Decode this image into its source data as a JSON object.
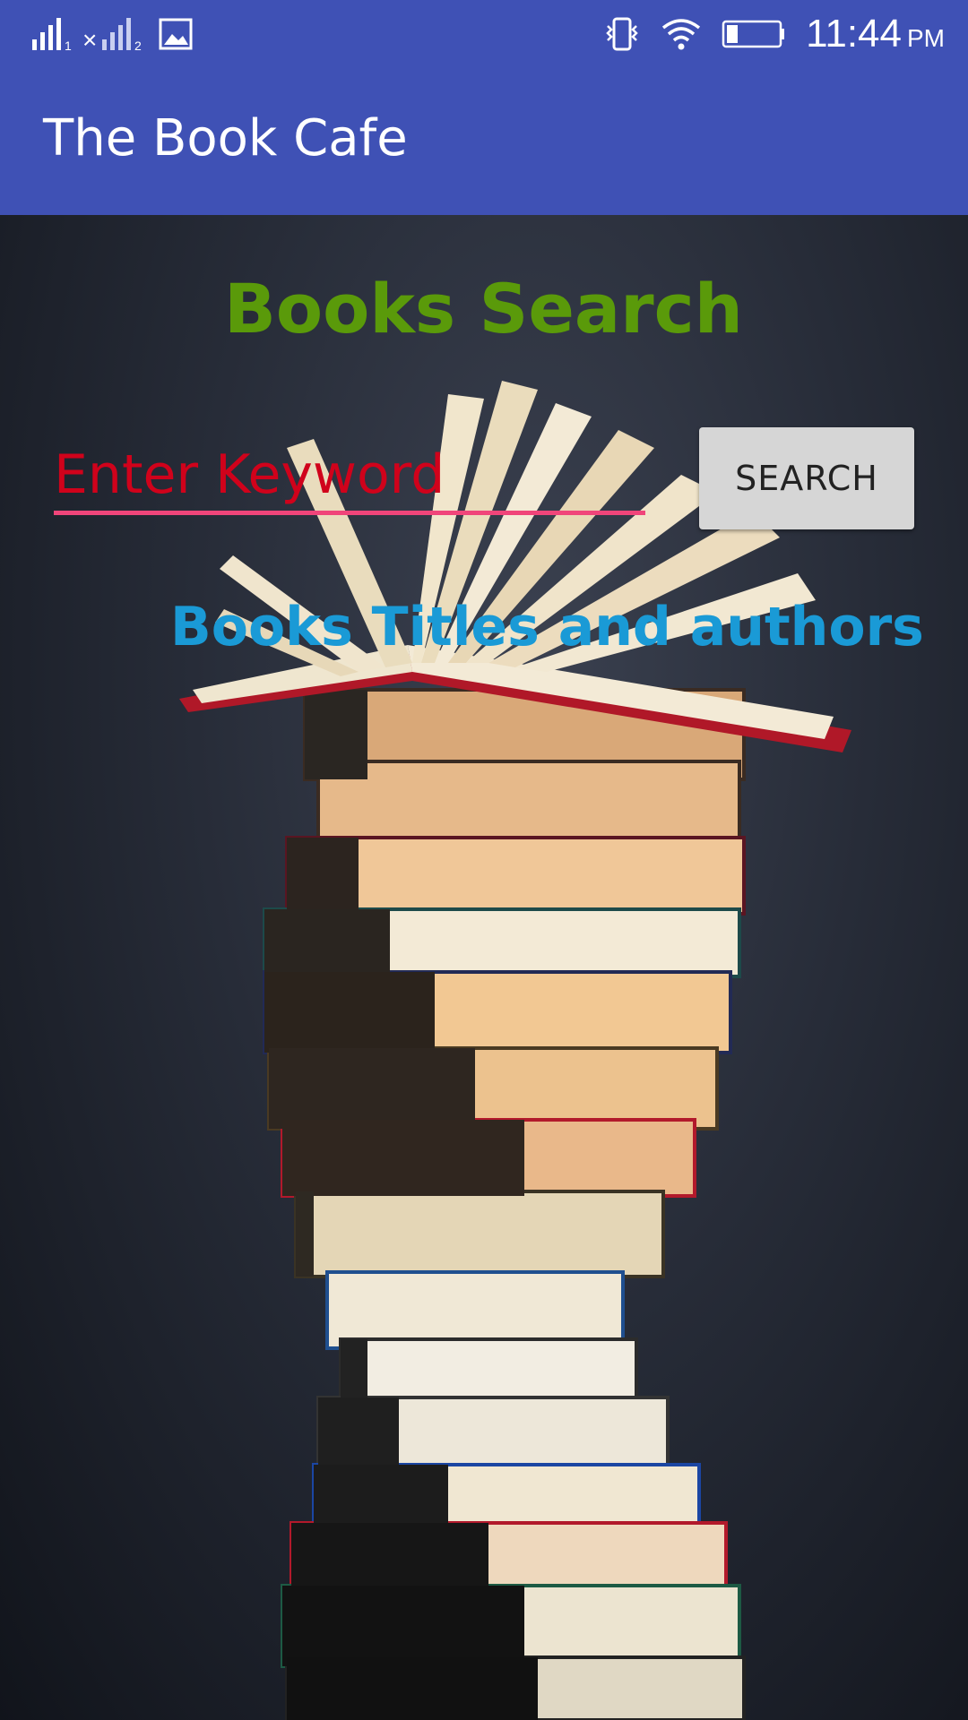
{
  "status_bar": {
    "time": "11:44",
    "ampm": "PM",
    "icons": [
      "signal-sim1-icon",
      "signal-sim2-icon",
      "gallery-notification-icon",
      "vibrate-icon",
      "wifi-icon",
      "battery-icon"
    ],
    "sim1_label": "1",
    "sim2_label": "2"
  },
  "app_bar": {
    "title": "The Book Cafe",
    "color": "#3f51b5"
  },
  "main": {
    "heading": "Books Search",
    "heading_color": "#5a9a0a",
    "search": {
      "placeholder": "Enter Keyword",
      "value": "",
      "placeholder_color": "#d0021b",
      "underline_color": "#f0457a"
    },
    "search_button_label": "SEARCH",
    "results_label": "Books Titles and authors",
    "results_label_color": "#1a9ad6",
    "background_image": "stack-of-books"
  }
}
